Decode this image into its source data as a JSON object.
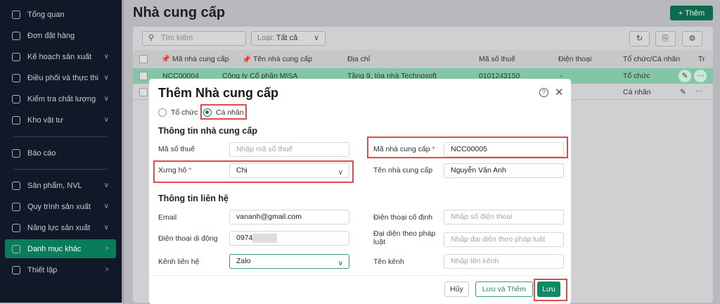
{
  "sidebar": {
    "items": [
      {
        "label": "Tổng quan",
        "icon": "home-icon",
        "chev": ""
      },
      {
        "label": "Đơn đặt hàng",
        "icon": "cart-icon",
        "chev": ""
      },
      {
        "label": "Kế hoạch sản xuất",
        "icon": "calendar-icon",
        "chev": "∨"
      },
      {
        "label": "Điều phối và thực thi",
        "icon": "calendar-clock-icon",
        "chev": "∨"
      },
      {
        "label": "Kiểm tra chất lượng",
        "icon": "check-circle-icon",
        "chev": "∨"
      },
      {
        "label": "Kho vật tư",
        "icon": "archive-icon",
        "chev": "∨"
      },
      {
        "label": "Báo cáo",
        "icon": "chart-icon",
        "chev": ""
      },
      {
        "label": "Sản phẩm, NVL",
        "icon": "box-icon",
        "chev": "∨"
      },
      {
        "label": "Quy trình sản xuất",
        "icon": "process-icon",
        "chev": "∨"
      },
      {
        "label": "Năng lực sản xuất",
        "icon": "user-capacity-icon",
        "chev": "∨"
      },
      {
        "label": "Danh mục khác",
        "icon": "grid-icon",
        "chev": ">"
      },
      {
        "label": "Thiết lập",
        "icon": "gear-icon",
        "chev": ">"
      }
    ]
  },
  "page": {
    "title": "Nhà cung cấp",
    "add_label": "+ Thêm"
  },
  "toolbar": {
    "search_placeholder": "Tìm kiếm",
    "filter_label": "Loại:",
    "filter_value": "Tất cả"
  },
  "table": {
    "headers": [
      "Mã nhà cung cấp",
      "Tên nhà cung cấp",
      "Địa chỉ",
      "Mã số thuế",
      "Điện thoại",
      "Tổ chức/Cá nhân",
      "Tr"
    ],
    "rows": [
      {
        "code": "NCC00004",
        "name": "Công ty Cổ phần MISA",
        "address": "Tầng 9, tòa nhà Technosoft",
        "tax": "0101243150",
        "phone": "-",
        "type": "Tổ chức"
      },
      {
        "type": "Cá nhân"
      }
    ]
  },
  "modal": {
    "title": "Thêm Nhà cung cấp",
    "radio": [
      "Tổ chức",
      "Cá nhân"
    ],
    "section1": "Thông tin nhà cung cấp",
    "section2": "Thông tin liên hệ",
    "tax_label": "Mã số thuế",
    "tax_placeholder": "Nhập mã số thuế",
    "code_label": "Mã nhà cung cấp",
    "code_value": "NCC00005",
    "salutation_label": "Xưng hô",
    "salutation_value": "Chị",
    "name_label": "Tên nhà cung cấp",
    "name_value": "Nguyễn Vân Anh",
    "email_label": "Email",
    "email_value": "vananh@gmail.com",
    "landline_label": "Điện thoại cố định",
    "landline_placeholder": "Nhập số điện thoại",
    "mobile_label": "Điện thoại di động",
    "mobile_value": "0974",
    "rep_label": "Đại diện theo pháp luật",
    "rep_placeholder": "Nhập đại diện theo pháp luật",
    "channel_label": "Kênh liên hệ",
    "channel_value": "Zalo",
    "channel_name_label": "Tên kênh",
    "channel_name_placeholder": "Nhập tên kênh",
    "required_mark": "*",
    "cancel": "Hủy",
    "save_add": "Lưu và Thêm",
    "save": "Lưu"
  },
  "colors": {
    "accent": "#0a7c5c",
    "highlight": "#e04b4b"
  }
}
